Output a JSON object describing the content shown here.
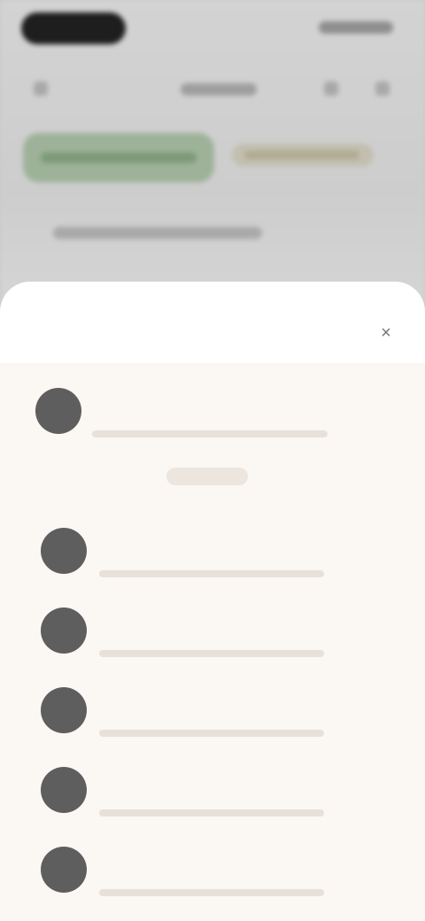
{
  "background": {
    "icons": [
      "left-icon",
      "right-icon-1",
      "right-icon-2"
    ]
  },
  "sheet": {
    "title": "",
    "close_icon": "×",
    "items": [
      {
        "avatar": "",
        "name": "",
        "meta": "",
        "badge": "",
        "action": ""
      },
      {
        "avatar": "",
        "name": "",
        "meta": "",
        "badge": ""
      },
      {
        "avatar": "",
        "name": "",
        "meta": "",
        "badge": ""
      },
      {
        "avatar": "",
        "name": "",
        "meta": "",
        "badge": ""
      },
      {
        "avatar": "",
        "name": "",
        "meta": "",
        "badge": ""
      },
      {
        "avatar": "",
        "name": "",
        "meta": "",
        "badge": ""
      }
    ]
  },
  "colors": {
    "accent_green": "#9db298",
    "sheet_list_bg": "#fbf7f3",
    "avatar": "#5e5e5e"
  }
}
